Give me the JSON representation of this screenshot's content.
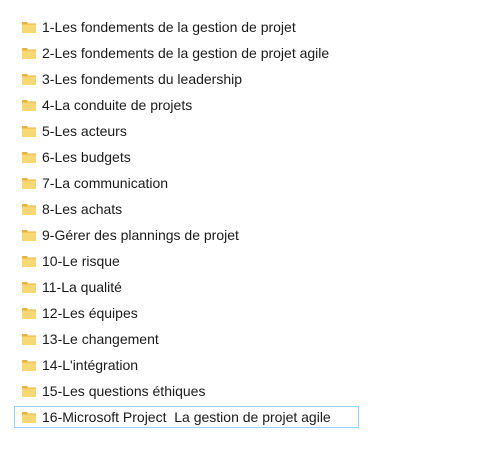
{
  "folders": [
    {
      "label": "1-Les fondements de la gestion de projet",
      "icon": "folder-icon"
    },
    {
      "label": "2-Les fondements de la gestion de projet agile",
      "icon": "folder-icon"
    },
    {
      "label": "3-Les fondements du leadership",
      "icon": "folder-icon"
    },
    {
      "label": "4-La conduite de projets",
      "icon": "folder-icon"
    },
    {
      "label": "5-Les acteurs",
      "icon": "folder-icon"
    },
    {
      "label": "6-Les budgets",
      "icon": "folder-icon"
    },
    {
      "label": "7-La communication",
      "icon": "folder-icon"
    },
    {
      "label": "8-Les achats",
      "icon": "folder-icon"
    },
    {
      "label": "9-Gérer des plannings de projet",
      "icon": "folder-icon"
    },
    {
      "label": "10-Le risque",
      "icon": "folder-icon"
    },
    {
      "label": "11-La qualité",
      "icon": "folder-icon"
    },
    {
      "label": "12-Les équipes",
      "icon": "folder-icon"
    },
    {
      "label": "13-Le changement",
      "icon": "folder-icon"
    },
    {
      "label": "14-L'intégration",
      "icon": "folder-icon"
    },
    {
      "label": "15-Les questions éthiques",
      "icon": "folder-icon"
    },
    {
      "label": "16-Microsoft Project  La gestion de projet agile",
      "icon": "folder-icon"
    }
  ],
  "selected_index": 15,
  "colors": {
    "folder_body": "#f8d775",
    "folder_back": "#e8b440",
    "selection_border": "#99d1ff",
    "text": "#1a1a1a"
  }
}
